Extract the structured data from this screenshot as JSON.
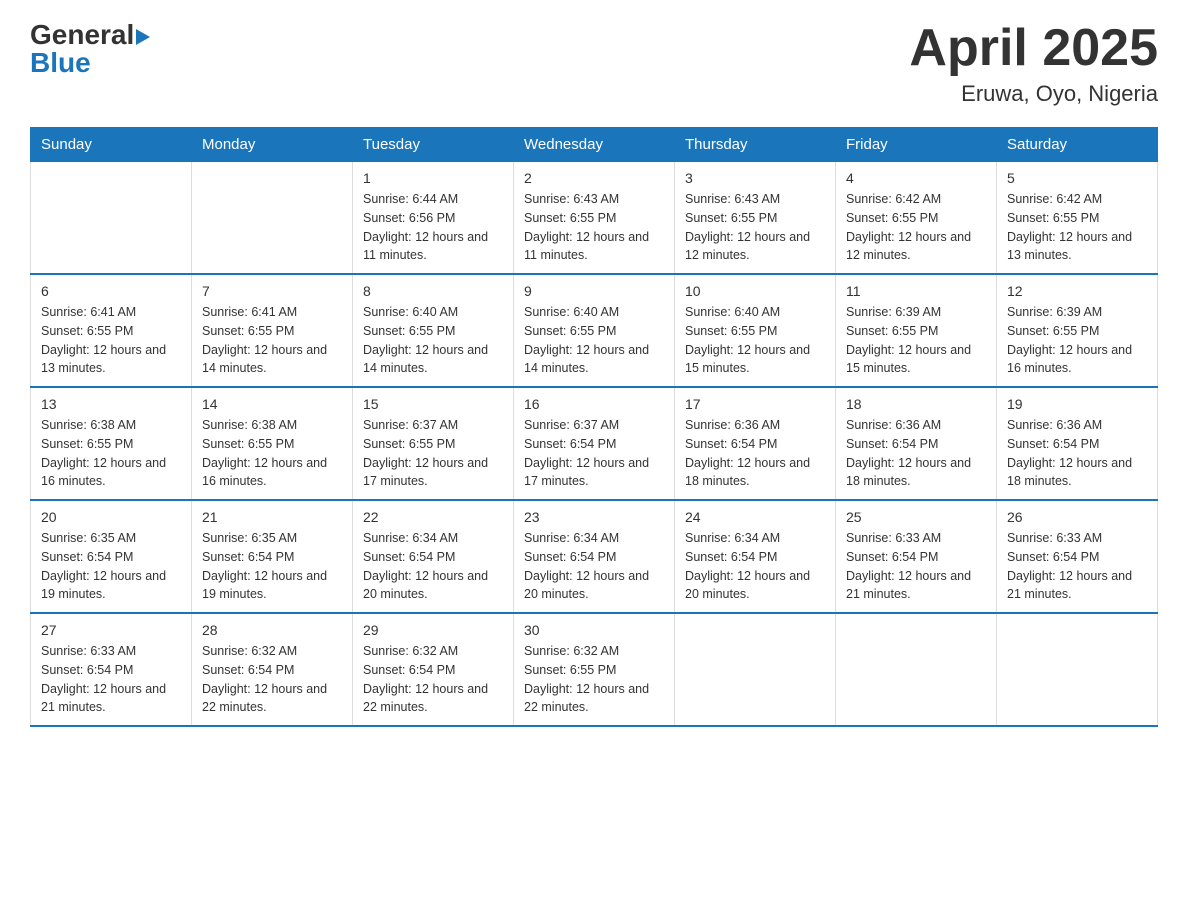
{
  "header": {
    "logo": {
      "general": "General",
      "blue": "Blue",
      "triangle": "▲"
    },
    "title": "April 2025",
    "subtitle": "Eruwa, Oyo, Nigeria"
  },
  "weekdays": [
    "Sunday",
    "Monday",
    "Tuesday",
    "Wednesday",
    "Thursday",
    "Friday",
    "Saturday"
  ],
  "weeks": [
    [
      {
        "day": "",
        "info": ""
      },
      {
        "day": "",
        "info": ""
      },
      {
        "day": "1",
        "info": "Sunrise: 6:44 AM\nSunset: 6:56 PM\nDaylight: 12 hours and 11 minutes."
      },
      {
        "day": "2",
        "info": "Sunrise: 6:43 AM\nSunset: 6:55 PM\nDaylight: 12 hours and 11 minutes."
      },
      {
        "day": "3",
        "info": "Sunrise: 6:43 AM\nSunset: 6:55 PM\nDaylight: 12 hours and 12 minutes."
      },
      {
        "day": "4",
        "info": "Sunrise: 6:42 AM\nSunset: 6:55 PM\nDaylight: 12 hours and 12 minutes."
      },
      {
        "day": "5",
        "info": "Sunrise: 6:42 AM\nSunset: 6:55 PM\nDaylight: 12 hours and 13 minutes."
      }
    ],
    [
      {
        "day": "6",
        "info": "Sunrise: 6:41 AM\nSunset: 6:55 PM\nDaylight: 12 hours and 13 minutes."
      },
      {
        "day": "7",
        "info": "Sunrise: 6:41 AM\nSunset: 6:55 PM\nDaylight: 12 hours and 14 minutes."
      },
      {
        "day": "8",
        "info": "Sunrise: 6:40 AM\nSunset: 6:55 PM\nDaylight: 12 hours and 14 minutes."
      },
      {
        "day": "9",
        "info": "Sunrise: 6:40 AM\nSunset: 6:55 PM\nDaylight: 12 hours and 14 minutes."
      },
      {
        "day": "10",
        "info": "Sunrise: 6:40 AM\nSunset: 6:55 PM\nDaylight: 12 hours and 15 minutes."
      },
      {
        "day": "11",
        "info": "Sunrise: 6:39 AM\nSunset: 6:55 PM\nDaylight: 12 hours and 15 minutes."
      },
      {
        "day": "12",
        "info": "Sunrise: 6:39 AM\nSunset: 6:55 PM\nDaylight: 12 hours and 16 minutes."
      }
    ],
    [
      {
        "day": "13",
        "info": "Sunrise: 6:38 AM\nSunset: 6:55 PM\nDaylight: 12 hours and 16 minutes."
      },
      {
        "day": "14",
        "info": "Sunrise: 6:38 AM\nSunset: 6:55 PM\nDaylight: 12 hours and 16 minutes."
      },
      {
        "day": "15",
        "info": "Sunrise: 6:37 AM\nSunset: 6:55 PM\nDaylight: 12 hours and 17 minutes."
      },
      {
        "day": "16",
        "info": "Sunrise: 6:37 AM\nSunset: 6:54 PM\nDaylight: 12 hours and 17 minutes."
      },
      {
        "day": "17",
        "info": "Sunrise: 6:36 AM\nSunset: 6:54 PM\nDaylight: 12 hours and 18 minutes."
      },
      {
        "day": "18",
        "info": "Sunrise: 6:36 AM\nSunset: 6:54 PM\nDaylight: 12 hours and 18 minutes."
      },
      {
        "day": "19",
        "info": "Sunrise: 6:36 AM\nSunset: 6:54 PM\nDaylight: 12 hours and 18 minutes."
      }
    ],
    [
      {
        "day": "20",
        "info": "Sunrise: 6:35 AM\nSunset: 6:54 PM\nDaylight: 12 hours and 19 minutes."
      },
      {
        "day": "21",
        "info": "Sunrise: 6:35 AM\nSunset: 6:54 PM\nDaylight: 12 hours and 19 minutes."
      },
      {
        "day": "22",
        "info": "Sunrise: 6:34 AM\nSunset: 6:54 PM\nDaylight: 12 hours and 20 minutes."
      },
      {
        "day": "23",
        "info": "Sunrise: 6:34 AM\nSunset: 6:54 PM\nDaylight: 12 hours and 20 minutes."
      },
      {
        "day": "24",
        "info": "Sunrise: 6:34 AM\nSunset: 6:54 PM\nDaylight: 12 hours and 20 minutes."
      },
      {
        "day": "25",
        "info": "Sunrise: 6:33 AM\nSunset: 6:54 PM\nDaylight: 12 hours and 21 minutes."
      },
      {
        "day": "26",
        "info": "Sunrise: 6:33 AM\nSunset: 6:54 PM\nDaylight: 12 hours and 21 minutes."
      }
    ],
    [
      {
        "day": "27",
        "info": "Sunrise: 6:33 AM\nSunset: 6:54 PM\nDaylight: 12 hours and 21 minutes."
      },
      {
        "day": "28",
        "info": "Sunrise: 6:32 AM\nSunset: 6:54 PM\nDaylight: 12 hours and 22 minutes."
      },
      {
        "day": "29",
        "info": "Sunrise: 6:32 AM\nSunset: 6:54 PM\nDaylight: 12 hours and 22 minutes."
      },
      {
        "day": "30",
        "info": "Sunrise: 6:32 AM\nSunset: 6:55 PM\nDaylight: 12 hours and 22 minutes."
      },
      {
        "day": "",
        "info": ""
      },
      {
        "day": "",
        "info": ""
      },
      {
        "day": "",
        "info": ""
      }
    ]
  ]
}
